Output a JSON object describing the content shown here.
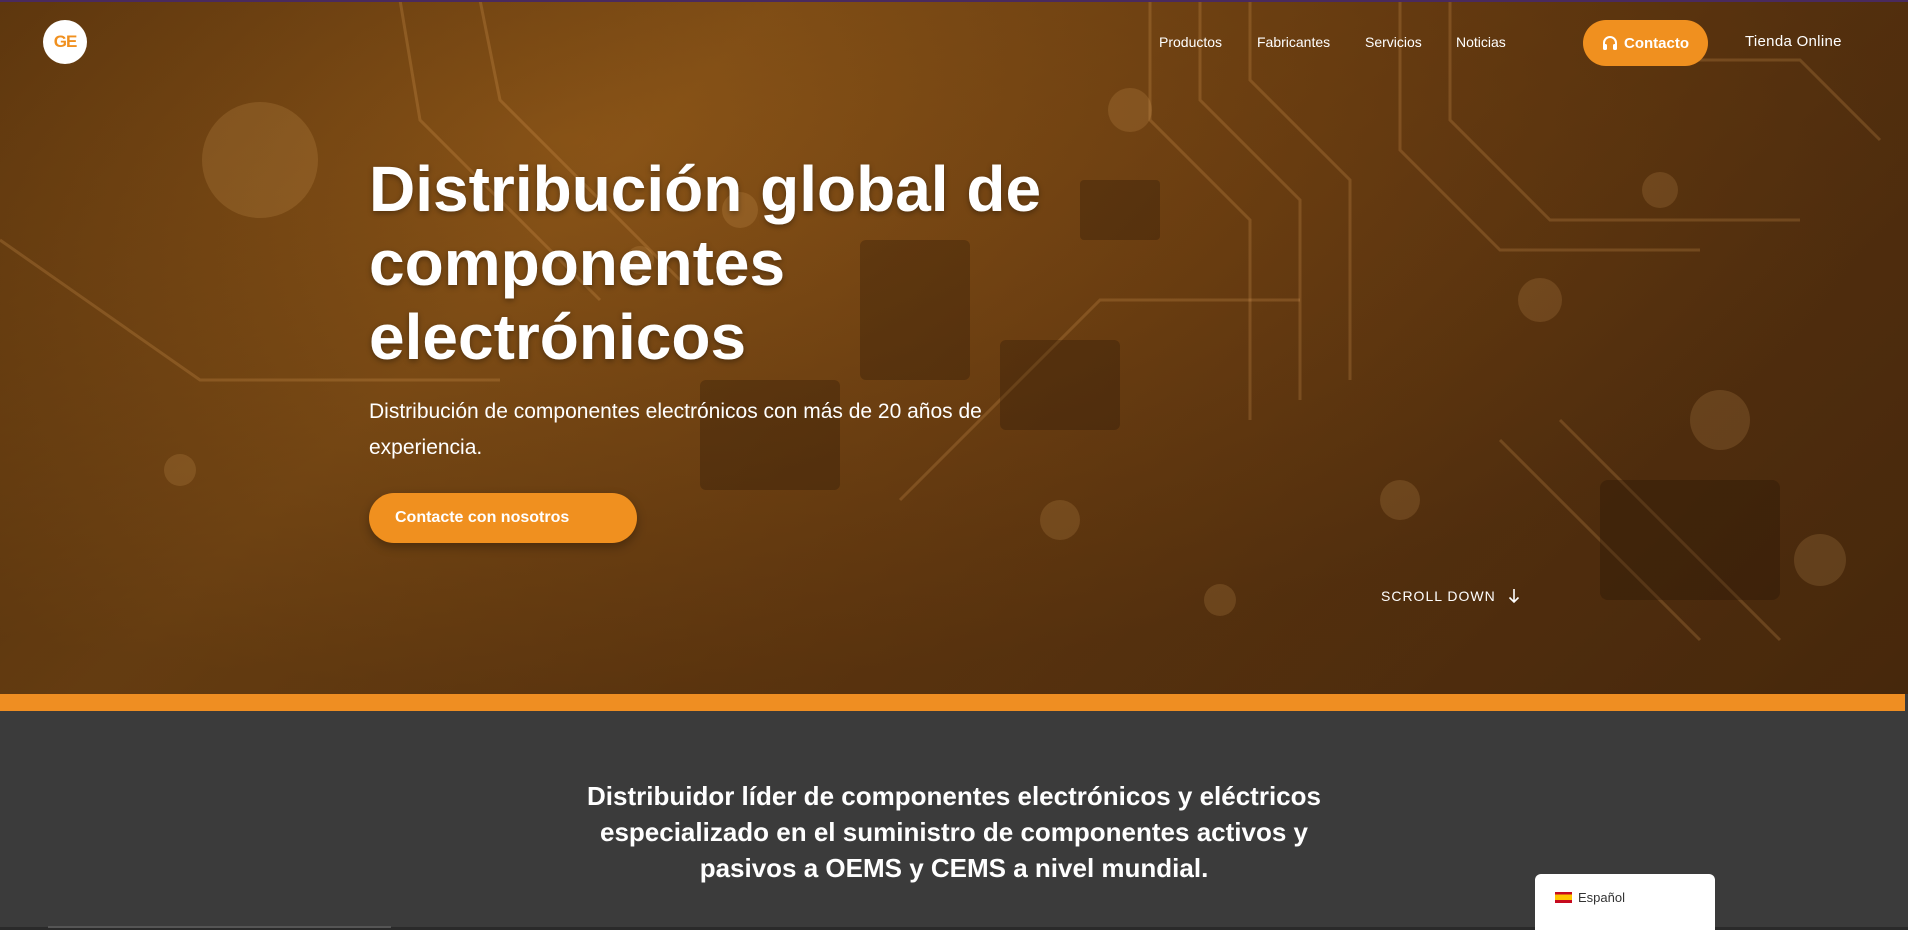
{
  "brand": {
    "logo_text": "GE"
  },
  "nav": {
    "items": [
      "Productos",
      "Fabricantes",
      "Servicios",
      "Noticias"
    ],
    "contact_label": "Contacto",
    "shop_label": "Tienda Online"
  },
  "hero": {
    "title": "Distribución global de componentes electrónicos",
    "subtitle": "Distribución de componentes electrónicos con más de 20 años de experiencia.",
    "cta_label": "Contacte con nosotros",
    "scroll_label": "SCROLL DOWN"
  },
  "intro": {
    "text": "Distribuidor líder de componentes electrónicos y eléctricos especializado en el suministro de componentes activos y pasivos a OEMS y CEMS a nivel mundial."
  },
  "language": {
    "label": "Español",
    "icon": "spain-flag-icon"
  },
  "colors": {
    "accent": "#f0901f",
    "dark_section": "#3b3b3b",
    "hero_tint": "#8a5417"
  }
}
